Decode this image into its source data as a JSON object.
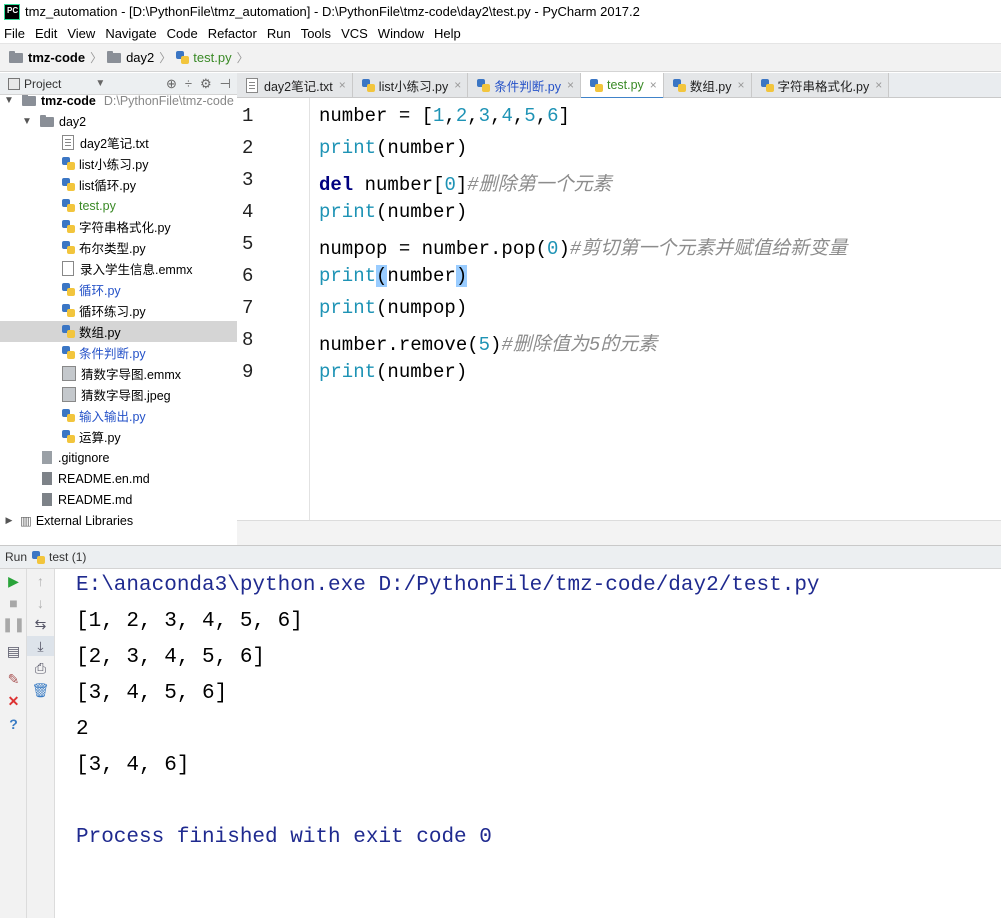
{
  "window": {
    "title": "tmz_automation - [D:\\PythonFile\\tmz_automation] - D:\\PythonFile\\tmz-code\\day2\\test.py - PyCharm 2017.2",
    "logo": "PC"
  },
  "menu": [
    "File",
    "Edit",
    "View",
    "Navigate",
    "Code",
    "Refactor",
    "Run",
    "Tools",
    "VCS",
    "Window",
    "Help"
  ],
  "breadcrumb": {
    "root": "tmz-code",
    "folder": "day2",
    "file": "test.py"
  },
  "project_panel": {
    "label": "Project",
    "dropdown_icon": "chevron-down-icon"
  },
  "tree": [
    {
      "label": "tmz-code",
      "path": "D:\\PythonFile\\tmz-code",
      "type": "folder",
      "depth": 0,
      "expanded": true
    },
    {
      "label": "day2",
      "type": "folder",
      "depth": 1,
      "expanded": true
    },
    {
      "label": "day2笔记.txt",
      "type": "txt",
      "depth": 2,
      "status": "none"
    },
    {
      "label": "list小练习.py",
      "type": "py",
      "depth": 2,
      "status": "none"
    },
    {
      "label": "list循环.py",
      "type": "py",
      "depth": 2,
      "status": "none"
    },
    {
      "label": "test.py",
      "type": "py",
      "depth": 2,
      "status": "added"
    },
    {
      "label": "字符串格式化.py",
      "type": "py",
      "depth": 2,
      "status": "none"
    },
    {
      "label": "布尔类型.py",
      "type": "py",
      "depth": 2,
      "status": "none"
    },
    {
      "label": "录入学生信息.emmx",
      "type": "file",
      "depth": 2,
      "status": "none"
    },
    {
      "label": "循环.py",
      "type": "py",
      "depth": 2,
      "status": "modified"
    },
    {
      "label": "循环练习.py",
      "type": "py",
      "depth": 2,
      "status": "none"
    },
    {
      "label": "数组.py",
      "type": "py",
      "depth": 2,
      "status": "none",
      "selected": true
    },
    {
      "label": "条件判断.py",
      "type": "py",
      "depth": 2,
      "status": "modified"
    },
    {
      "label": "猜数字导图.emmx",
      "type": "mm",
      "depth": 2,
      "status": "none"
    },
    {
      "label": "猜数字导图.jpeg",
      "type": "mm",
      "depth": 2,
      "status": "none"
    },
    {
      "label": "输入输出.py",
      "type": "py",
      "depth": 2,
      "status": "modified"
    },
    {
      "label": "运算.py",
      "type": "py",
      "depth": 2,
      "status": "none"
    },
    {
      "label": ".gitignore",
      "type": "git",
      "depth": 1,
      "status": "none"
    },
    {
      "label": "README.en.md",
      "type": "md",
      "depth": 1,
      "status": "none"
    },
    {
      "label": "README.md",
      "type": "md",
      "depth": 1,
      "status": "none"
    },
    {
      "label": "External Libraries",
      "type": "lib",
      "depth": 0,
      "collapsed": true
    }
  ],
  "tabs": [
    {
      "label": "day2笔记.txt",
      "type": "txt",
      "status": "none"
    },
    {
      "label": "list小练习.py",
      "type": "py",
      "status": "none"
    },
    {
      "label": "条件判断.py",
      "type": "py",
      "status": "modified"
    },
    {
      "label": "test.py",
      "type": "py",
      "status": "added",
      "active": true
    },
    {
      "label": "数组.py",
      "type": "py",
      "status": "none"
    },
    {
      "label": "字符串格式化.py",
      "type": "py",
      "status": "none"
    }
  ],
  "editor": {
    "current_line": 6,
    "lines": [
      {
        "n": "1",
        "parts": [
          [
            "plain",
            "number = ["
          ],
          [
            "num",
            "1"
          ],
          [
            "plain",
            ","
          ],
          [
            "num",
            "2"
          ],
          [
            "plain",
            ","
          ],
          [
            "num",
            "3"
          ],
          [
            "plain",
            ","
          ],
          [
            "num",
            "4"
          ],
          [
            "plain",
            ","
          ],
          [
            "num",
            "5"
          ],
          [
            "plain",
            ","
          ],
          [
            "num",
            "6"
          ],
          [
            "plain",
            "]"
          ]
        ]
      },
      {
        "n": "2",
        "parts": [
          [
            "print",
            "print"
          ],
          [
            "plain",
            "(number)"
          ]
        ]
      },
      {
        "n": "3",
        "parts": [
          [
            "del",
            "del"
          ],
          [
            "plain",
            " number["
          ],
          [
            "num",
            "0"
          ],
          [
            "plain",
            "]"
          ],
          [
            "cmt",
            "#删除第一个元素"
          ]
        ]
      },
      {
        "n": "4",
        "parts": [
          [
            "print",
            "print"
          ],
          [
            "plain",
            "(number)"
          ]
        ]
      },
      {
        "n": "5",
        "parts": [
          [
            "plain",
            "numpop = number.pop("
          ],
          [
            "num",
            "0"
          ],
          [
            "plain",
            ")"
          ],
          [
            "cmt",
            "#剪切第一个元素并赋值给新变量"
          ]
        ]
      },
      {
        "n": "6",
        "parts": [
          [
            "print",
            "print"
          ],
          [
            "hl",
            "("
          ],
          [
            "plain",
            "number"
          ],
          [
            "hl",
            ")"
          ]
        ]
      },
      {
        "n": "7",
        "parts": [
          [
            "print",
            "print"
          ],
          [
            "plain",
            "(numpop)"
          ]
        ]
      },
      {
        "n": "8",
        "parts": [
          [
            "plain",
            "number.remove("
          ],
          [
            "num",
            "5"
          ],
          [
            "plain",
            ")"
          ],
          [
            "cmt",
            "#删除值为5的元素"
          ]
        ]
      },
      {
        "n": "9",
        "parts": [
          [
            "print",
            "print"
          ],
          [
            "plain",
            "(number)"
          ]
        ]
      }
    ]
  },
  "run": {
    "label": "Run",
    "config": "test (1)",
    "output": [
      {
        "kind": "cmd",
        "text": "E:\\anaconda3\\python.exe D:/PythonFile/tmz-code/day2/test.py"
      },
      {
        "kind": "plain",
        "text": "[1, 2, 3, 4, 5, 6]"
      },
      {
        "kind": "plain",
        "text": "[2, 3, 4, 5, 6]"
      },
      {
        "kind": "plain",
        "text": "[3, 4, 5, 6]"
      },
      {
        "kind": "plain",
        "text": "2"
      },
      {
        "kind": "plain",
        "text": "[3, 4, 6]"
      },
      {
        "kind": "blank",
        "text": ""
      },
      {
        "kind": "done",
        "text": "Process finished with exit code 0"
      }
    ]
  },
  "colors": {
    "accent": "#4083c9",
    "added": "#3a8a26",
    "modified": "#2552c8",
    "keyword_blue": "#1e93b5",
    "console_blue": "#1f2a8f"
  }
}
